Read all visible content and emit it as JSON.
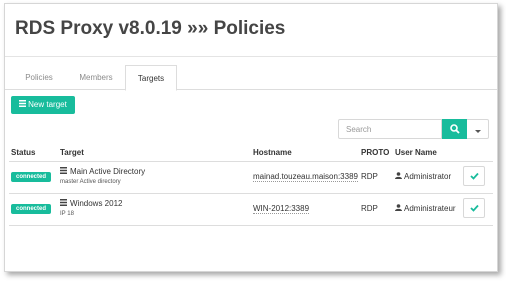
{
  "page": {
    "title": "RDS Proxy v8.0.19 »» Policies"
  },
  "tabs": [
    {
      "label": "Policies",
      "active": false
    },
    {
      "label": "Members",
      "active": false
    },
    {
      "label": "Targets",
      "active": true
    }
  ],
  "toolbar": {
    "new_target_label": "New target",
    "new_target_icon": "list-icon"
  },
  "search": {
    "placeholder": "Search",
    "button_icon": "search-icon",
    "dropdown_icon": "caret-down-icon"
  },
  "table": {
    "headers": {
      "status": "Status",
      "target": "Target",
      "hostname": "Hostname",
      "proto": "PROTO",
      "user": "User Name"
    },
    "rows": [
      {
        "status": "connected",
        "target": "Main Active Directory",
        "subtitle": "master Active directory",
        "hostname": "mainad.touzeau.maison:3389",
        "proto": "RDP",
        "user": "Administrator"
      },
      {
        "status": "connected",
        "target": "Windows 2012",
        "subtitle": "IP 18",
        "hostname": "WIN-2012:3389",
        "proto": "RDP",
        "user": "Administrateur"
      }
    ]
  },
  "colors": {
    "accent": "#18bc9c",
    "text": "#333333",
    "border": "#dddddd"
  }
}
